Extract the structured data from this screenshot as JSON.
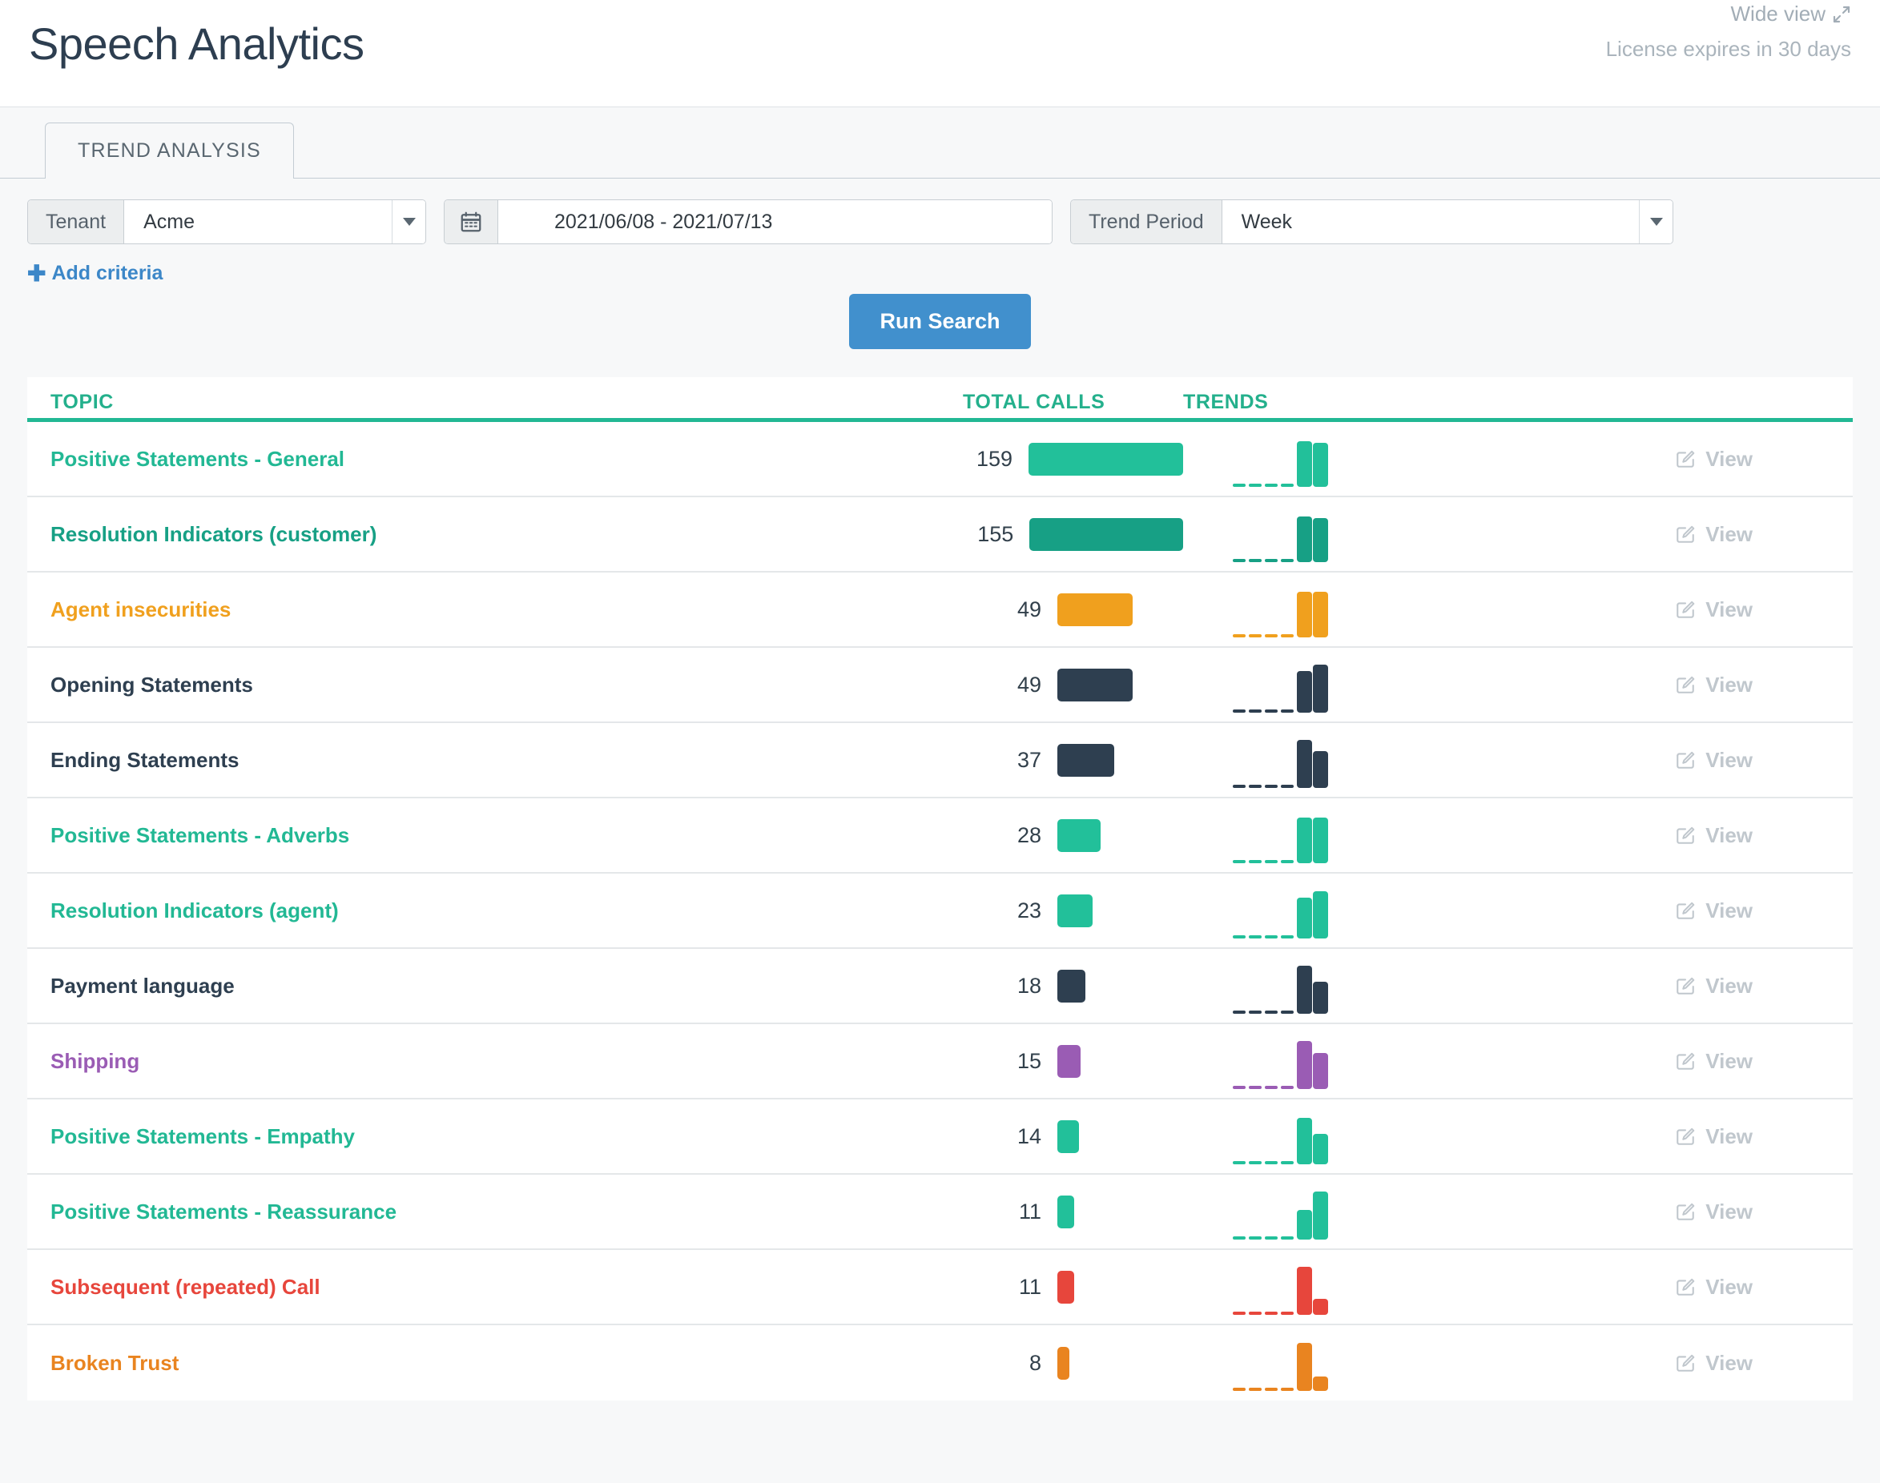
{
  "header": {
    "title": "Speech Analytics",
    "wide_view_label": "Wide view",
    "wide_view_icon": "expand-arrows-icon",
    "license_note": "License expires in 30 days"
  },
  "tabs": [
    {
      "label": "TREND ANALYSIS",
      "active": true
    }
  ],
  "filters": {
    "tenant": {
      "label": "Tenant",
      "value": "Acme",
      "caret_icon": "chevron-down-icon"
    },
    "date_range": {
      "icon": "calendar-icon",
      "value": "2021/06/08 - 2021/07/13"
    },
    "trend_period": {
      "label": "Trend Period",
      "value": "Week",
      "caret_icon": "chevron-down-icon"
    },
    "add_criteria_label": "Add criteria",
    "add_criteria_icon": "plus-icon"
  },
  "actions": {
    "run_search_label": "Run Search",
    "view_label": "View",
    "view_icon": "pencil-square-icon"
  },
  "colors": {
    "accent_green": "#24b08c",
    "deep_green": "#17a085",
    "orange": "#f0a01e",
    "dark_navy": "#2e3f50",
    "purple": "#9a5cb4",
    "red": "#e7463c",
    "dark_orange": "#e98420",
    "primary_blue": "#4190cd"
  },
  "table": {
    "columns": [
      "TOPIC",
      "TOTAL CALLS",
      "TRENDS",
      ""
    ],
    "max_calls": 159,
    "rows": [
      {
        "topic": "Positive Statements - General",
        "total_calls": 159,
        "color": "#22c09a",
        "trend": [
          1,
          1,
          1,
          1,
          57,
          55
        ]
      },
      {
        "topic": "Resolution Indicators (customer)",
        "total_calls": 155,
        "color": "#17a085",
        "trend": [
          1,
          1,
          1,
          1,
          57,
          55
        ]
      },
      {
        "topic": "Agent insecurities",
        "total_calls": 49,
        "color": "#f0a01e",
        "trend": [
          1,
          1,
          1,
          1,
          57,
          57
        ]
      },
      {
        "topic": "Opening Statements",
        "total_calls": 49,
        "color": "#2e3f50",
        "trend": [
          1,
          1,
          1,
          1,
          52,
          60
        ]
      },
      {
        "topic": "Ending Statements",
        "total_calls": 37,
        "color": "#2e3f50",
        "trend": [
          1,
          1,
          1,
          1,
          60,
          46
        ]
      },
      {
        "topic": "Positive Statements - Adverbs",
        "total_calls": 28,
        "color": "#22c09a",
        "trend": [
          1,
          1,
          1,
          1,
          57,
          57
        ]
      },
      {
        "topic": "Resolution Indicators (agent)",
        "total_calls": 23,
        "color": "#22c09a",
        "trend": [
          1,
          1,
          1,
          1,
          51,
          59
        ]
      },
      {
        "topic": "Payment language",
        "total_calls": 18,
        "color": "#2e3f50",
        "trend": [
          1,
          1,
          1,
          1,
          60,
          40
        ]
      },
      {
        "topic": "Shipping",
        "total_calls": 15,
        "color": "#9a5cb4",
        "trend": [
          1,
          1,
          1,
          1,
          60,
          45
        ]
      },
      {
        "topic": "Positive Statements - Empathy",
        "total_calls": 14,
        "color": "#22c09a",
        "trend": [
          1,
          1,
          1,
          1,
          58,
          38
        ]
      },
      {
        "topic": "Positive Statements - Reassurance",
        "total_calls": 11,
        "color": "#22c09a",
        "trend": [
          1,
          1,
          1,
          1,
          37,
          60
        ]
      },
      {
        "topic": "Subsequent (repeated) Call",
        "total_calls": 11,
        "color": "#e7463c",
        "trend": [
          1,
          1,
          1,
          1,
          60,
          20
        ]
      },
      {
        "topic": "Broken Trust",
        "total_calls": 8,
        "color": "#e98420",
        "trend": [
          1,
          1,
          1,
          1,
          60,
          18
        ]
      }
    ]
  }
}
